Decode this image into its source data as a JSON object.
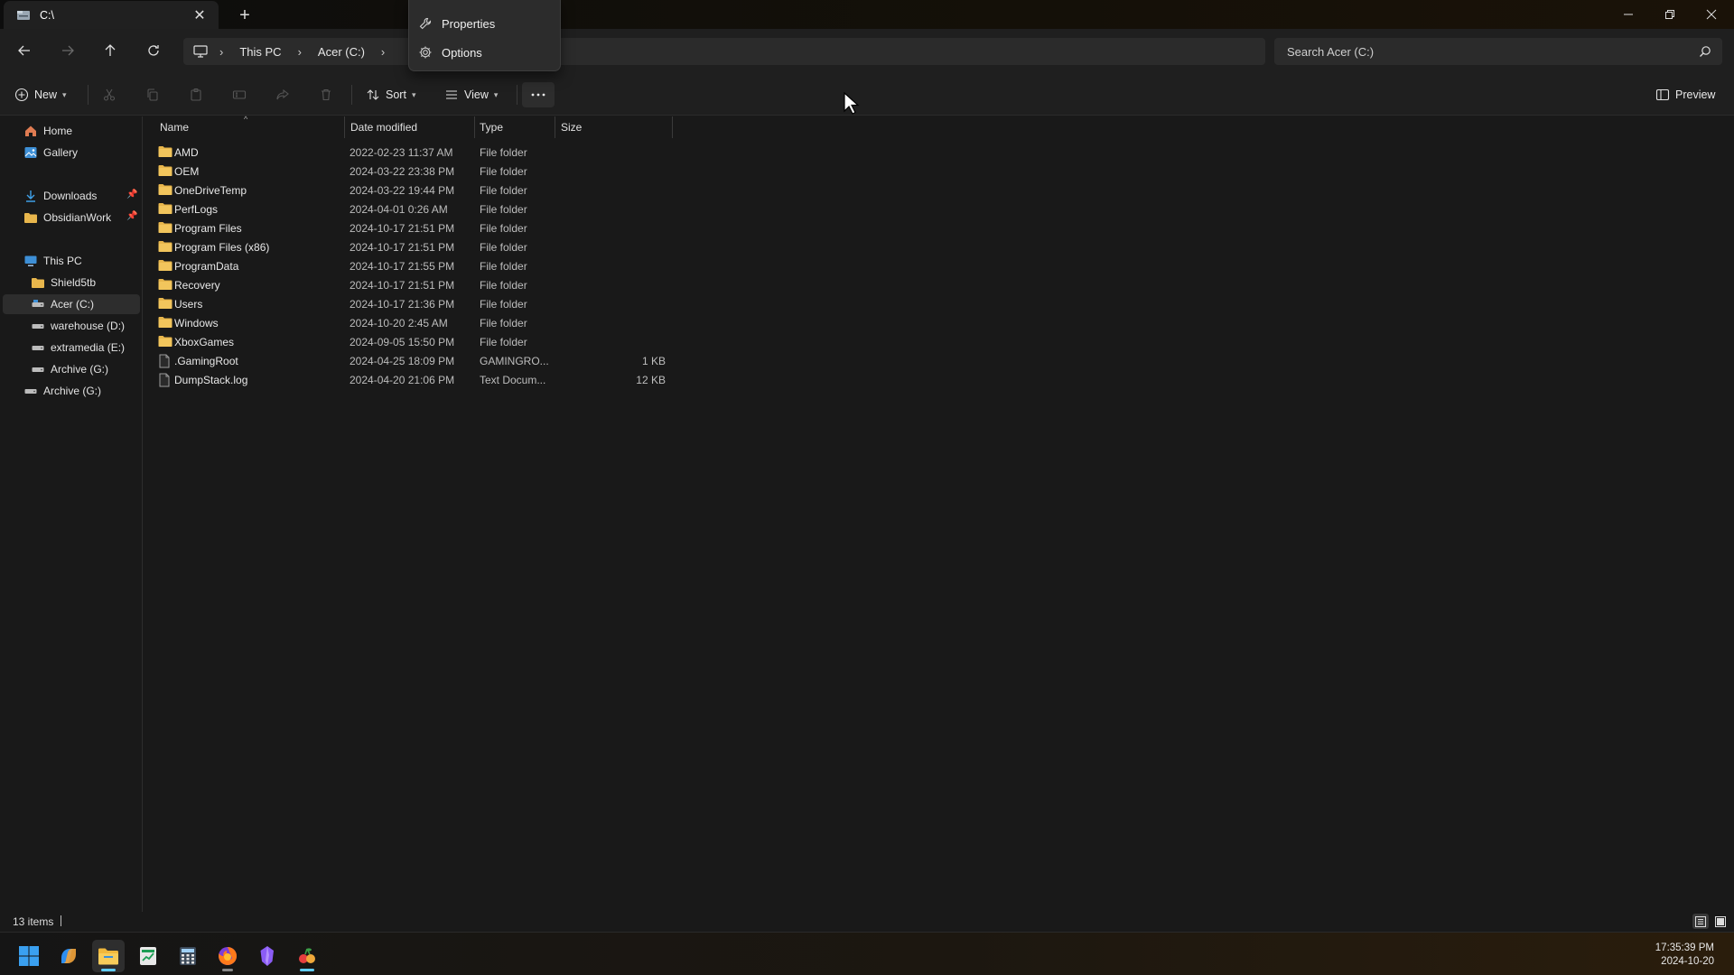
{
  "window": {
    "tab_title": "C:\\",
    "new_tab": "+"
  },
  "nav": {
    "breadcrumbs": [
      "This PC",
      "Acer (C:)"
    ],
    "search_placeholder": "Search Acer (C:)"
  },
  "menu": {
    "items": [
      "Properties",
      "Options"
    ]
  },
  "toolbar": {
    "new_label": "New",
    "sort_label": "Sort",
    "view_label": "View",
    "preview_label": "Preview"
  },
  "sidebar": {
    "quick": [
      {
        "label": "Home",
        "icon": "home-icon"
      },
      {
        "label": "Gallery",
        "icon": "gallery-icon"
      }
    ],
    "pinned": [
      {
        "label": "Downloads",
        "icon": "download-icon"
      },
      {
        "label": "ObsidianWork",
        "icon": "folder-icon"
      }
    ],
    "this_pc": "This PC",
    "drives": [
      {
        "label": "Shield5tb",
        "icon": "folder-icon"
      },
      {
        "label": "Acer (C:)",
        "icon": "drive-icon"
      },
      {
        "label": "warehouse (D:)",
        "icon": "drive-icon"
      },
      {
        "label": "extramedia (E:)",
        "icon": "drive-icon"
      },
      {
        "label": "Archive (G:)",
        "icon": "drive-icon"
      }
    ],
    "archive": "Archive (G:)"
  },
  "columns": {
    "name": "Name",
    "date": "Date modified",
    "type": "Type",
    "size": "Size"
  },
  "files": [
    {
      "name": "AMD",
      "date": "2022-02-23 11:37 AM",
      "type": "File folder",
      "size": "",
      "kind": "folder"
    },
    {
      "name": "OEM",
      "date": "2024-03-22 23:38 PM",
      "type": "File folder",
      "size": "",
      "kind": "folder"
    },
    {
      "name": "OneDriveTemp",
      "date": "2024-03-22 19:44 PM",
      "type": "File folder",
      "size": "",
      "kind": "folder"
    },
    {
      "name": "PerfLogs",
      "date": "2024-04-01 0:26 AM",
      "type": "File folder",
      "size": "",
      "kind": "folder"
    },
    {
      "name": "Program Files",
      "date": "2024-10-17 21:51 PM",
      "type": "File folder",
      "size": "",
      "kind": "folder"
    },
    {
      "name": "Program Files (x86)",
      "date": "2024-10-17 21:51 PM",
      "type": "File folder",
      "size": "",
      "kind": "folder"
    },
    {
      "name": "ProgramData",
      "date": "2024-10-17 21:55 PM",
      "type": "File folder",
      "size": "",
      "kind": "folder"
    },
    {
      "name": "Recovery",
      "date": "2024-10-17 21:51 PM",
      "type": "File folder",
      "size": "",
      "kind": "folder"
    },
    {
      "name": "Users",
      "date": "2024-10-17 21:36 PM",
      "type": "File folder",
      "size": "",
      "kind": "folder"
    },
    {
      "name": "Windows",
      "date": "2024-10-20 2:45 AM",
      "type": "File folder",
      "size": "",
      "kind": "folder"
    },
    {
      "name": "XboxGames",
      "date": "2024-09-05 15:50 PM",
      "type": "File folder",
      "size": "",
      "kind": "folder"
    },
    {
      "name": ".GamingRoot",
      "date": "2024-04-25 18:09 PM",
      "type": "GAMINGRO...",
      "size": "1 KB",
      "kind": "file"
    },
    {
      "name": "DumpStack.log",
      "date": "2024-04-20 21:06 PM",
      "type": "Text Docum...",
      "size": "12 KB",
      "kind": "file"
    }
  ],
  "status": {
    "count": "13 items"
  },
  "clock": {
    "time": "17:35:39 PM",
    "date": "2024-10-20"
  },
  "colors": {
    "folder": "#e8b64c",
    "accent": "#60cdff"
  }
}
